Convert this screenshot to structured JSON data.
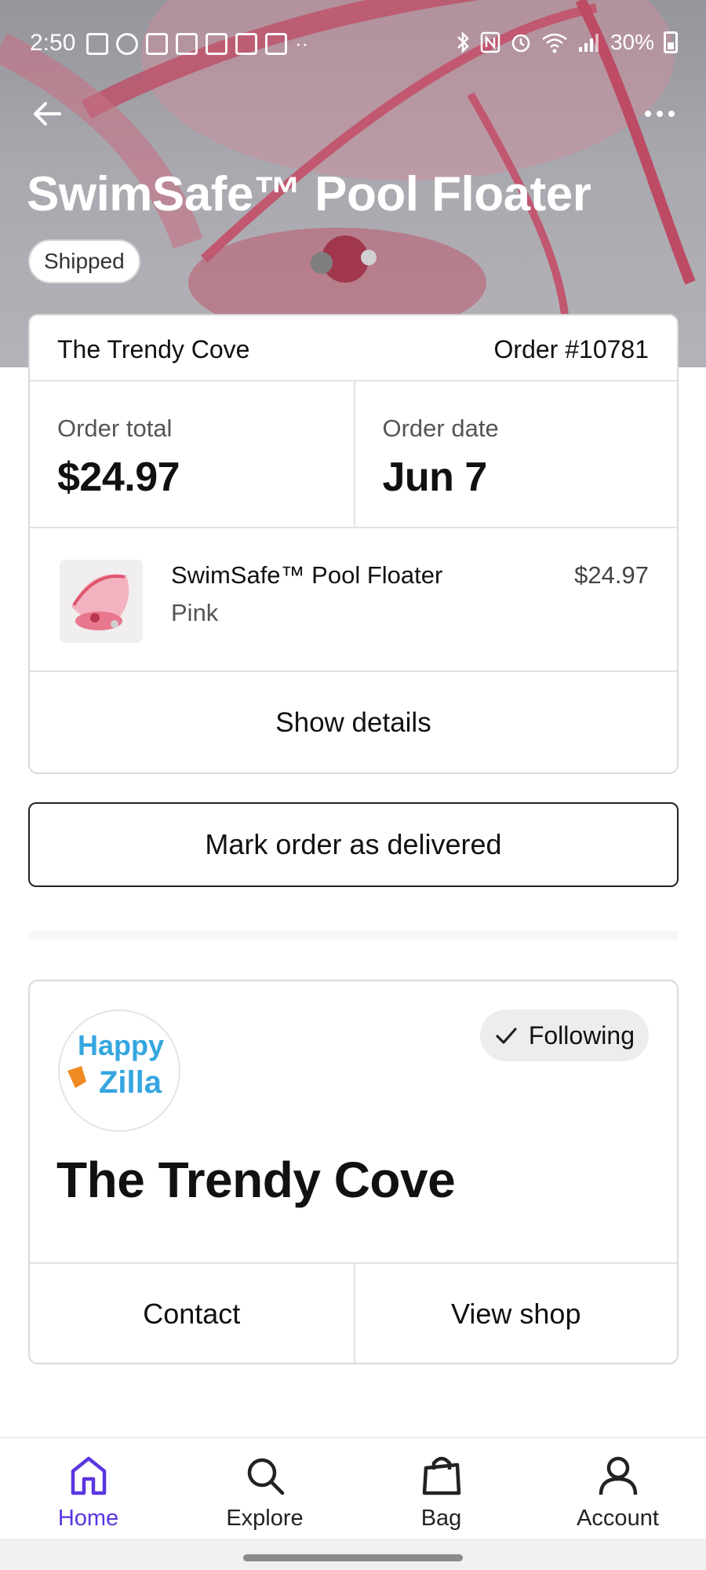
{
  "status_bar": {
    "time": "2:50",
    "battery_text": "30%",
    "left_icons": [
      "message-icon",
      "dollar-icon",
      "barcode-icon",
      "barcode-icon",
      "plus-box-icon",
      "w-icon",
      "image-icon",
      "more-icon"
    ],
    "right_icons": [
      "bluetooth-icon",
      "nfc-icon",
      "alarm-icon",
      "wifi-icon",
      "signal-icon",
      "battery-icon"
    ]
  },
  "hero": {
    "title": "SwimSafe™ Pool Floater",
    "status_badge": "Shipped"
  },
  "order": {
    "shop_name": "The Trendy Cove",
    "order_number": "Order #10781",
    "total_label": "Order total",
    "total_value": "$24.97",
    "date_label": "Order date",
    "date_value": "Jun 7",
    "item": {
      "name": "SwimSafe™ Pool Floater",
      "variant": "Pink",
      "price": "$24.97"
    },
    "show_details_label": "Show details"
  },
  "mark_delivered_label": "Mark order as delivered",
  "shop_card": {
    "logo_text_top": "Happy",
    "logo_text_bottom": "Zilla",
    "follow_label": "Following",
    "name": "The Trendy Cove",
    "contact_label": "Contact",
    "view_shop_label": "View shop"
  },
  "bottom_nav": {
    "items": [
      {
        "label": "Home",
        "icon": "home-icon",
        "active": true
      },
      {
        "label": "Explore",
        "icon": "search-icon",
        "active": false
      },
      {
        "label": "Bag",
        "icon": "bag-icon",
        "active": false
      },
      {
        "label": "Account",
        "icon": "account-icon",
        "active": false
      }
    ]
  },
  "colors": {
    "accent": "#5a35e0",
    "product_pink": "#e0566f",
    "logo_blue": "#35a6e0",
    "logo_orange": "#f08a24"
  }
}
